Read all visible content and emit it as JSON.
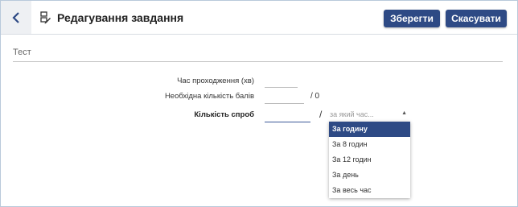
{
  "header": {
    "title": "Редагування завдання",
    "save_label": "Зберегти",
    "cancel_label": "Скасувати"
  },
  "form": {
    "name_value": "Тест",
    "time_label": "Час проходження (хв)",
    "time_value": "",
    "score_label": "Необхідна кількість балів",
    "score_value": "",
    "score_max": "/ 0",
    "tries_label": "Кількість спроб",
    "tries_value": "",
    "tries_separator": "/",
    "period_placeholder": "за який час..."
  },
  "dropdown": {
    "options": [
      "За годину",
      "За 8 годин",
      "За 12 годин",
      "За день",
      "За весь час"
    ],
    "selected_index": 0
  },
  "colors": {
    "accent": "#2e4a85",
    "border": "#b9c9db"
  }
}
